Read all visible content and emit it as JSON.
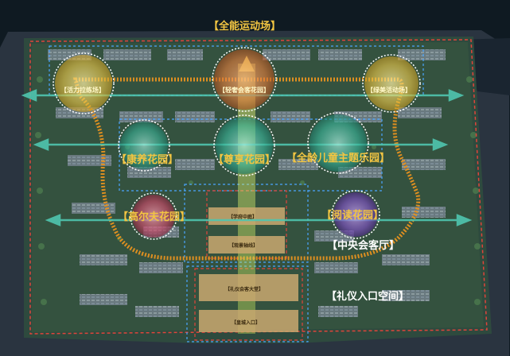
{
  "labels": {
    "sports_field": "【全能运动场】",
    "vitality_fitness": "【活力拉练场】",
    "light_club": "【轻奢会客花园】",
    "landscape_activity": "【绿美活动场】",
    "health_garden": "【康养花园】",
    "respect_garden": "【尊享花园】",
    "kids_park": "【全龄儿童主题乐园】",
    "golf_garden": "【高尔夫花园】",
    "reading_garden": "【阅读花园】",
    "central_lounge": "【中央会客厅】",
    "courtyard_center": "【学府中庭】",
    "axis": "【观景轴线】",
    "reception_hall": "【礼仪会客大堂】",
    "entrance": "【皇城入口】",
    "ceremony_space": "【礼仪入口空间】"
  },
  "colors": {
    "background": "#0f1a22",
    "site": "#2e4a3e",
    "label_yellow": "#f2c542",
    "path_orange": "#e8921f",
    "arrow_teal": "#4fc6b0",
    "boundary_red": "#e0443b",
    "dash_blue": "#4aa6ff",
    "plaque": "#caa870"
  },
  "icons": [
    "east-west-arrow-icon",
    "north-arrow-icon",
    "circle-node-icon"
  ]
}
